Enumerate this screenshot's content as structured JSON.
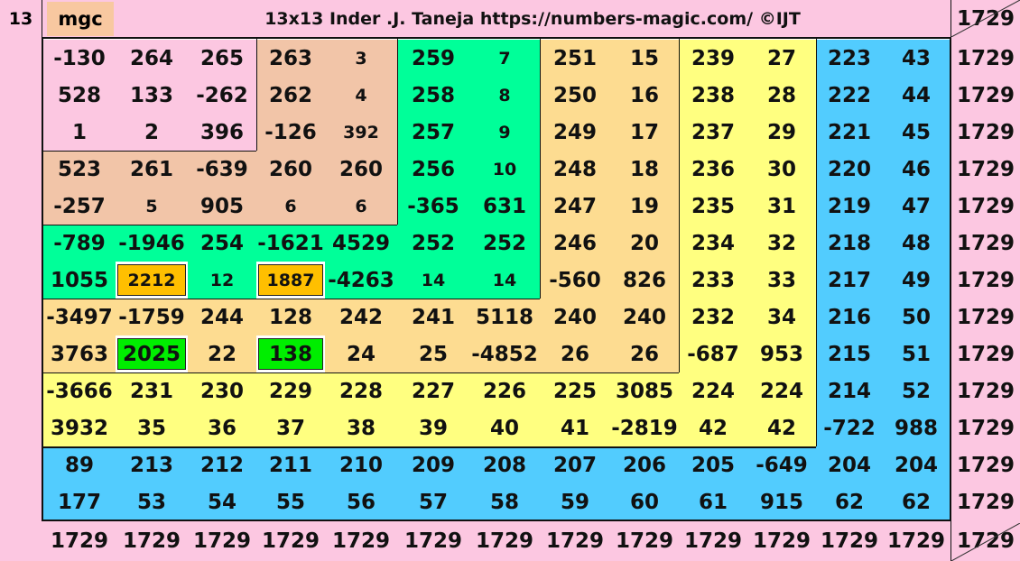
{
  "header": {
    "order_label": "13",
    "mgc_label": "mgc",
    "title": "13x13  Inder .J. Taneja    https://numbers-magic.com/  ©IJT"
  },
  "magic_sum": "1729",
  "grid": [
    [
      "-130",
      "264",
      "265",
      "263",
      "3",
      "259",
      "7",
      "251",
      "15",
      "239",
      "27",
      "223",
      "43"
    ],
    [
      "528",
      "133",
      "-262",
      "262",
      "4",
      "258",
      "8",
      "250",
      "16",
      "238",
      "28",
      "222",
      "44"
    ],
    [
      "1",
      "2",
      "396",
      "-126",
      "392",
      "257",
      "9",
      "249",
      "17",
      "237",
      "29",
      "221",
      "45"
    ],
    [
      "523",
      "261",
      "-639",
      "260",
      "260",
      "256",
      "10",
      "248",
      "18",
      "236",
      "30",
      "220",
      "46"
    ],
    [
      "-257",
      "5",
      "905",
      "6",
      "6",
      "-365",
      "631",
      "247",
      "19",
      "235",
      "31",
      "219",
      "47"
    ],
    [
      "-789",
      "-1946",
      "254",
      "-1621",
      "4529",
      "252",
      "252",
      "246",
      "20",
      "234",
      "32",
      "218",
      "48"
    ],
    [
      "1055",
      "2212",
      "12",
      "1887",
      "-4263",
      "14",
      "14",
      "-560",
      "826",
      "233",
      "33",
      "217",
      "49"
    ],
    [
      "-3497",
      "-1759",
      "244",
      "128",
      "242",
      "241",
      "5118",
      "240",
      "240",
      "232",
      "34",
      "216",
      "50"
    ],
    [
      "3763",
      "2025",
      "22",
      "138",
      "24",
      "25",
      "-4852",
      "26",
      "26",
      "-687",
      "953",
      "215",
      "51"
    ],
    [
      "-3666",
      "231",
      "230",
      "229",
      "228",
      "227",
      "226",
      "225",
      "3085",
      "224",
      "224",
      "214",
      "52"
    ],
    [
      "3932",
      "35",
      "36",
      "37",
      "38",
      "39",
      "40",
      "41",
      "-2819",
      "42",
      "42",
      "-722",
      "988"
    ],
    [
      "89",
      "213",
      "212",
      "211",
      "210",
      "209",
      "208",
      "207",
      "206",
      "205",
      "-649",
      "204",
      "204"
    ],
    [
      "177",
      "53",
      "54",
      "55",
      "56",
      "57",
      "58",
      "59",
      "60",
      "61",
      "915",
      "62",
      "62"
    ]
  ],
  "row_sums": [
    "1729",
    "1729",
    "1729",
    "1729",
    "1729",
    "1729",
    "1729",
    "1729",
    "1729",
    "1729",
    "1729",
    "1729",
    "1729"
  ],
  "column_sums": [
    "1729",
    "1729",
    "1729",
    "1729",
    "1729",
    "1729",
    "1729",
    "1729",
    "1729",
    "1729",
    "1729",
    "1729",
    "1729"
  ],
  "diagonal_sums": [
    "1729",
    "1729"
  ],
  "colors": {
    "pink": "#fcc7e1",
    "salmon": "#f2c5a8",
    "mint": "#00ff99",
    "peach": "#fddc91",
    "yellow": "#ffff80",
    "sky": "#52ccfe",
    "orange": "#ffbf00",
    "green": "#00ee00"
  }
}
